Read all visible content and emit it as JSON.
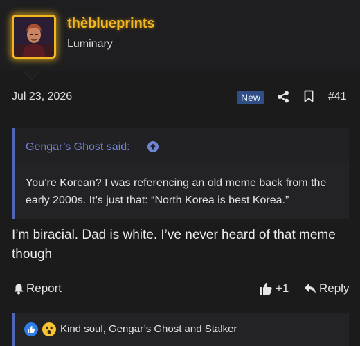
{
  "user": {
    "username": "thèblueprints",
    "title": "Luminary",
    "accent_color": "#f4b722"
  },
  "post": {
    "date": "Jul 23, 2026",
    "badge": "New",
    "number": "#41",
    "body": "I’m biracial. Dad is white. I’ve never heard of that meme though"
  },
  "quote": {
    "author": "Gengar’s Ghost said:",
    "text": "You’re Korean? I was referencing an old meme back from the early 2000s. It’s just that: “North Korea is best Korea.”",
    "accent_color": "#4f65b8"
  },
  "actions": {
    "report_label": "Report",
    "like_count": "+1",
    "reply_label": "Reply"
  },
  "reactions": {
    "text": "Kind soul, Gengar’s Ghost and Stalker",
    "icons": [
      "like-reaction-icon",
      "wow-reaction-icon"
    ]
  },
  "icons": {
    "share": "share-icon",
    "bookmark": "bookmark-icon",
    "quote_jump": "arrow-up-circle-icon",
    "report": "bell-icon",
    "like": "thumbs-up-icon",
    "reply": "reply-arrow-icon"
  }
}
